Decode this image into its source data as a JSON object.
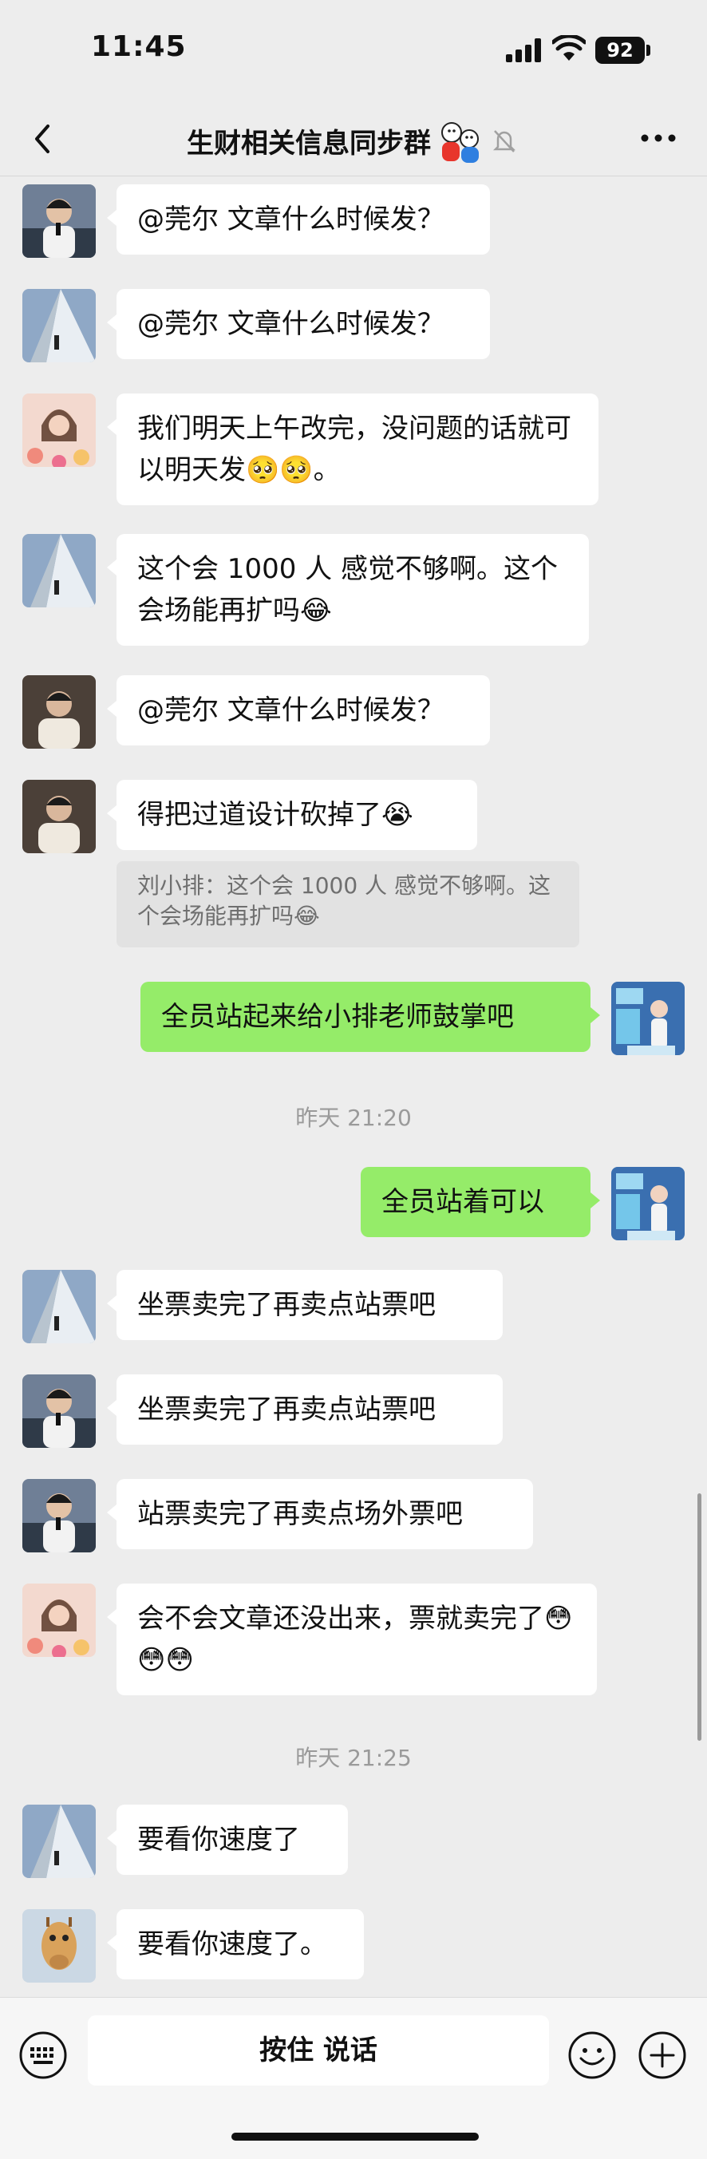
{
  "status_bar": {
    "time": "11:45",
    "battery": "92"
  },
  "nav": {
    "title": "生财相关信息同步群",
    "title_emoji_icon": "people-emoji-icon",
    "mute_icon": "bell-slash-icon"
  },
  "messages": [
    {
      "side": "left",
      "avatar": "avatar-man-mic",
      "text": "@莞尔 文章什么时候发？"
    },
    {
      "side": "left",
      "avatar": "avatar-stair-walker",
      "text": "@莞尔 文章什么时候发？"
    },
    {
      "side": "left",
      "avatar": "avatar-woman-flowers",
      "text": "我们明天上午改完，没问题的话就可以明天发🥺🥺。"
    },
    {
      "side": "left",
      "avatar": "avatar-stair-walker",
      "text": "这个会 1000 人 感觉不够啊。这个会场能再扩吗😂"
    },
    {
      "side": "left",
      "avatar": "avatar-man-dark",
      "text": "@莞尔 文章什么时候发？"
    },
    {
      "side": "left",
      "avatar": "avatar-man-dark",
      "text": "得把过道设计砍掉了😭",
      "quote": "刘小排：这个会 1000 人 感觉不够啊。这个会场能再扩吗😂"
    },
    {
      "side": "right",
      "avatar": "avatar-self",
      "text": "全员站起来给小排老师鼓掌吧"
    },
    {
      "side": "right",
      "avatar": "avatar-self",
      "text": "全员站着可以"
    },
    {
      "side": "left",
      "avatar": "avatar-stair-walker",
      "text": "坐票卖完了再卖点站票吧"
    },
    {
      "side": "left",
      "avatar": "avatar-man-mic",
      "text": "坐票卖完了再卖点站票吧"
    },
    {
      "side": "left",
      "avatar": "avatar-man-mic",
      "text": "站票卖完了再卖点场外票吧"
    },
    {
      "side": "left",
      "avatar": "avatar-woman-flowers",
      "text": "会不会文章还没出来，票就卖完了😳😳😳"
    },
    {
      "side": "left",
      "avatar": "avatar-stair-walker",
      "text": "要看你速度了"
    },
    {
      "side": "left",
      "avatar": "avatar-giraffe",
      "text": "要看你速度了。"
    }
  ],
  "timestamps": [
    "昨天 21:20",
    "昨天 21:25"
  ],
  "input": {
    "hold_to_talk": "按住 说话"
  }
}
